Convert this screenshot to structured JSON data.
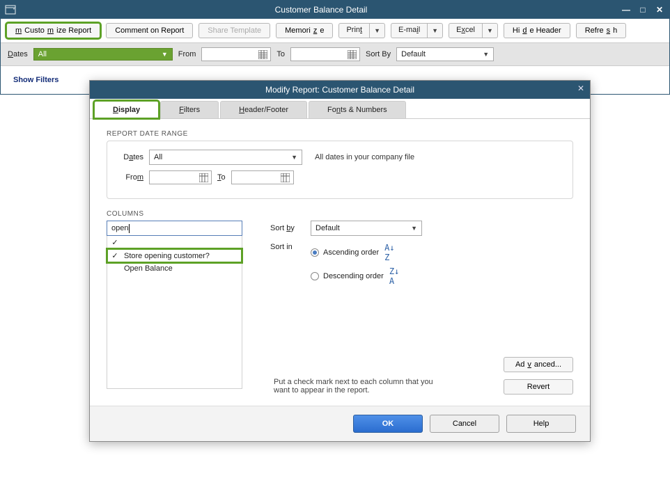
{
  "window": {
    "title": "Customer Balance Detail",
    "controls": {
      "min": "—",
      "max": "□",
      "close": "✕"
    }
  },
  "toolbar": {
    "customize": "Customize Report",
    "comment": "Comment on Report",
    "share": "Share Template",
    "memorize": "Memorize",
    "print": "Print",
    "email": "E-mail",
    "excel": "Excel",
    "hide": "Hide Header",
    "refresh": "Refresh"
  },
  "row2": {
    "dates_lbl": "Dates",
    "dates_val": "All",
    "from_lbl": "From",
    "to_lbl": "To",
    "sortby_lbl": "Sort By",
    "sortby_val": "Default"
  },
  "showfilters": "Show Filters",
  "modal": {
    "title": "Modify Report: Customer Balance Detail",
    "tabs": {
      "display": "Display",
      "filters": "Filters",
      "header": "Header/Footer",
      "fonts": "Fonts & Numbers"
    },
    "range": {
      "section": "REPORT DATE RANGE",
      "dates_lbl": "Dates",
      "dates_val": "All",
      "hint": "All dates in your company file",
      "from_lbl": "From",
      "to_lbl": "To"
    },
    "cols": {
      "section": "COLUMNS",
      "search": "open",
      "items": [
        {
          "checked": true,
          "label": ""
        },
        {
          "checked": true,
          "label": "Store opening customer?"
        },
        {
          "checked": false,
          "label": "Open Balance"
        }
      ],
      "sortby_lbl": "Sort by",
      "sortby_val": "Default",
      "sortin_lbl": "Sort in",
      "asc": "Ascending order",
      "desc": "Descending order",
      "help": "Put a check mark next to each column that you want to appear in the report.",
      "advanced": "Advanced...",
      "revert": "Revert"
    },
    "foot": {
      "ok": "OK",
      "cancel": "Cancel",
      "help": "Help"
    }
  }
}
